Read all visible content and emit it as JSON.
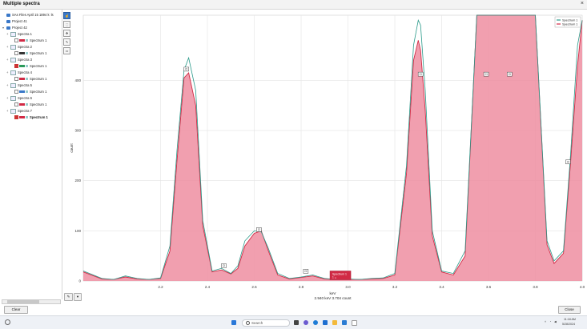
{
  "window": {
    "title": "Multiple spectra",
    "close_glyph": "×"
  },
  "tree": {
    "rows": [
      {
        "kind": "folder",
        "label": "SAs Files April 15 1894 k",
        "suffix": "ls",
        "indent": 0
      },
      {
        "kind": "folder",
        "label": "Project 41",
        "indent": 0
      },
      {
        "kind": "folder",
        "label": "Project 42",
        "indent": 0,
        "expander": "▾"
      },
      {
        "kind": "spectrum",
        "label": "Spectra 1",
        "indent": 1,
        "expander": "+"
      },
      {
        "kind": "item",
        "label": "Spectrum 1",
        "checked": false,
        "swatch": "#d12a45",
        "indent": 2
      },
      {
        "kind": "spectrum",
        "label": "Spectra 2",
        "indent": 1,
        "expander": "+"
      },
      {
        "kind": "item",
        "label": "Spectrum 1",
        "checked": false,
        "swatch": "#333333",
        "indent": 2
      },
      {
        "kind": "spectrum",
        "label": "Spectra 3",
        "indent": 1,
        "expander": "+"
      },
      {
        "kind": "item",
        "label": "Spectrum 1",
        "checked": true,
        "swatch": "#2a9a5a",
        "indent": 2
      },
      {
        "kind": "spectrum",
        "label": "Spectra 4",
        "indent": 1,
        "expander": "+"
      },
      {
        "kind": "item",
        "label": "Spectrum 1",
        "checked": false,
        "swatch": "#d12a45",
        "indent": 2
      },
      {
        "kind": "spectrum",
        "label": "Spectra 5",
        "indent": 1,
        "expander": "+"
      },
      {
        "kind": "item",
        "label": "Spectrum 1",
        "checked": false,
        "swatch": "#3a78c8",
        "indent": 2
      },
      {
        "kind": "spectrum",
        "label": "Spectra 6",
        "indent": 1,
        "expander": "+"
      },
      {
        "kind": "item",
        "label": "Spectrum 1",
        "checked": false,
        "swatch": "#d12a45",
        "indent": 2
      },
      {
        "kind": "spectrum",
        "label": "Spectra 7",
        "indent": 1,
        "expander": "+"
      },
      {
        "kind": "item",
        "label": "Spectrum 1",
        "checked": true,
        "swatch": "#d12a45",
        "indent": 2,
        "bold": true
      }
    ]
  },
  "toolbar": {
    "tools": [
      "pointer-icon",
      "zoom-box-icon",
      "pan-icon",
      "label-icon",
      "print-icon"
    ]
  },
  "chart_data": {
    "type": "area",
    "xlabel": "keV",
    "ylabel": "count",
    "xlim": [
      1.87,
      4.0
    ],
    "ylim": [
      0,
      530
    ],
    "x_ticks": [
      "2.2",
      "2.4",
      "2.6",
      "2.8",
      "3.0",
      "3.2",
      "3.4",
      "3.6",
      "3.8",
      "4.0"
    ],
    "x_tick_values": [
      2.2,
      2.4,
      2.6,
      2.8,
      3.0,
      3.2,
      3.4,
      3.6,
      3.8,
      4.0
    ],
    "y_ticks": [
      "0",
      "100",
      "200",
      "300",
      "400"
    ],
    "y_tick_values": [
      0,
      100,
      200,
      300,
      400
    ],
    "grid": true,
    "legend_position": "top-right",
    "series": [
      {
        "name": "Spectrum 1",
        "color": "#2a9a8a",
        "style": "line",
        "x": [
          1.87,
          1.95,
          2.0,
          2.05,
          2.1,
          2.15,
          2.2,
          2.24,
          2.27,
          2.3,
          2.32,
          2.35,
          2.38,
          2.42,
          2.46,
          2.5,
          2.53,
          2.56,
          2.6,
          2.63,
          2.66,
          2.7,
          2.75,
          2.8,
          2.85,
          2.9,
          2.95,
          3.0,
          3.05,
          3.1,
          3.15,
          3.2,
          3.25,
          3.28,
          3.3,
          3.31,
          3.33,
          3.36,
          3.4,
          3.45,
          3.5,
          3.55,
          3.6,
          3.7,
          3.8,
          3.85,
          3.88,
          3.92,
          3.95,
          3.98,
          4.0
        ],
        "y": [
          20,
          5,
          3,
          10,
          5,
          3,
          6,
          70,
          260,
          420,
          445,
          380,
          120,
          20,
          25,
          15,
          30,
          80,
          100,
          98,
          65,
          15,
          5,
          8,
          12,
          5,
          3,
          4,
          3,
          5,
          6,
          15,
          230,
          470,
          520,
          510,
          380,
          100,
          20,
          15,
          60,
          530,
          530,
          530,
          530,
          80,
          40,
          60,
          250,
          470,
          520
        ]
      },
      {
        "name": "Spectrum 1",
        "color": "#d12a45",
        "fill": "#ee8ea1",
        "style": "area",
        "x": [
          1.87,
          1.95,
          2.0,
          2.05,
          2.1,
          2.15,
          2.2,
          2.24,
          2.27,
          2.3,
          2.32,
          2.35,
          2.38,
          2.42,
          2.46,
          2.5,
          2.53,
          2.56,
          2.6,
          2.63,
          2.66,
          2.7,
          2.75,
          2.8,
          2.85,
          2.9,
          2.95,
          3.0,
          3.05,
          3.1,
          3.15,
          3.2,
          3.25,
          3.28,
          3.3,
          3.31,
          3.33,
          3.36,
          3.4,
          3.45,
          3.5,
          3.55,
          3.6,
          3.7,
          3.8,
          3.85,
          3.88,
          3.92,
          3.95,
          3.98,
          4.0
        ],
        "y": [
          18,
          4,
          3,
          8,
          4,
          3,
          5,
          60,
          240,
          405,
          415,
          350,
          110,
          18,
          22,
          14,
          25,
          70,
          95,
          100,
          60,
          12,
          4,
          7,
          10,
          4,
          3,
          3,
          3,
          4,
          5,
          12,
          215,
          440,
          480,
          460,
          340,
          90,
          18,
          12,
          50,
          530,
          530,
          530,
          530,
          72,
          35,
          55,
          235,
          430,
          520
        ]
      }
    ],
    "markers": [
      {
        "label": "Cl",
        "x": 2.31,
        "y": 420
      },
      {
        "label": "Cl",
        "x": 2.47,
        "y": 28
      },
      {
        "label": "Cl",
        "x": 2.62,
        "y": 100
      },
      {
        "label": "Cl",
        "x": 2.82,
        "y": 17
      },
      {
        "label": "Cl",
        "x": 3.31,
        "y": 410
      },
      {
        "label": "Cl",
        "x": 3.59,
        "y": 410
      },
      {
        "label": "Cl",
        "x": 3.69,
        "y": 410
      },
      {
        "label": "Cl",
        "x": 3.94,
        "y": 235
      }
    ],
    "cursor_tooltip": "Spectrum 1",
    "cursor_tooltip_sub": "1 ₂₁",
    "status": "2.940 keV  3.704 count"
  },
  "buttons": {
    "clear": "Clear",
    "close": "Close"
  },
  "footer_tools": [
    "wand-icon",
    "chevron-down-icon"
  ],
  "taskbar": {
    "search_placeholder": "Search",
    "time": "11:18 AM",
    "date": "5/28/2024"
  }
}
